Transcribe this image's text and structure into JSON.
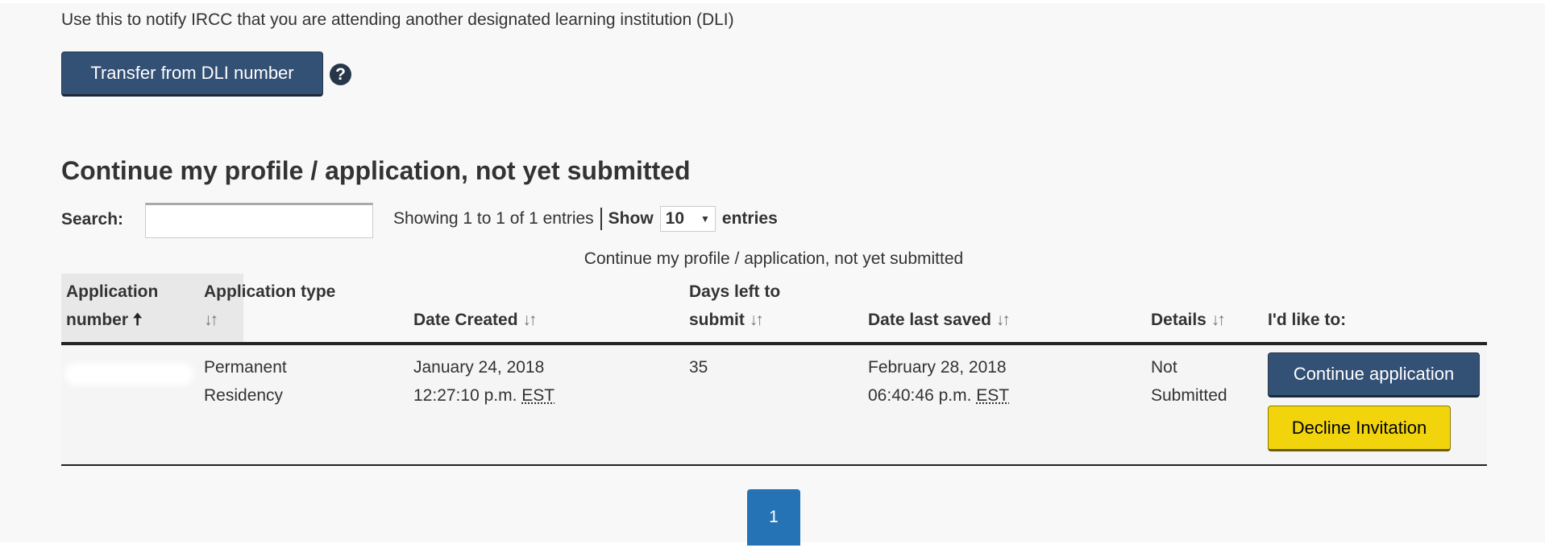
{
  "intro_text": "Use this to notify IRCC that you are attending another designated learning institution (DLI)",
  "transfer_button": "Transfer from DLI number",
  "help_icon": "?",
  "section_title": "Continue my profile / application, not yet submitted",
  "search": {
    "label": "Search:",
    "value": "",
    "placeholder": ""
  },
  "info": {
    "showing": "Showing 1 to 1 of 1 entries",
    "show": "Show",
    "page_size": "10",
    "entries": "entries"
  },
  "table": {
    "caption": "Continue my profile / application, not yet submitted",
    "headers": {
      "app_number_1": "Application",
      "app_number_2": "number",
      "app_type": "Application type",
      "date_created": "Date Created",
      "days_left_1": "Days left to",
      "days_left_2": "submit",
      "date_saved": "Date last saved",
      "details": "Details",
      "actions": "I'd like to:"
    },
    "sort_icon": "↓↑",
    "sort_active_icon": "🡅",
    "rows": [
      {
        "app_type_1": "Permanent",
        "app_type_2": "Residency",
        "date_created_1": "January 24, 2018",
        "date_created_2": "12:27:10 p.m.",
        "date_created_tz": "EST",
        "days_left": "35",
        "date_saved_1": "February 28, 2018",
        "date_saved_2": "06:40:46 p.m.",
        "date_saved_tz": "EST",
        "details_1": "Not",
        "details_2": "Submitted",
        "continue_label": "Continue application",
        "decline_label": "Decline Invitation"
      }
    ]
  },
  "pagination": {
    "current": "1"
  },
  "colors": {
    "primary": "#335075",
    "warning": "#f2d40d",
    "pagination": "#2572b4"
  }
}
